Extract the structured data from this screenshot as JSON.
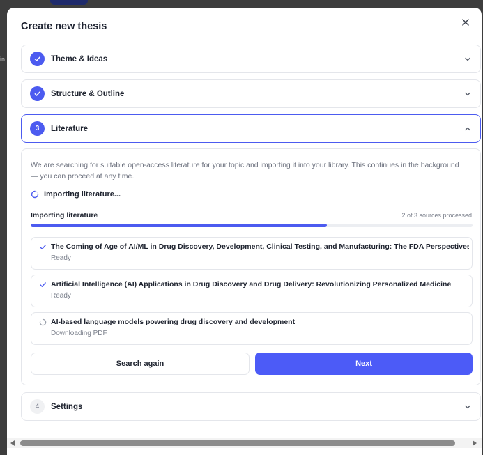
{
  "modal": {
    "title": "Create new thesis",
    "close_icon": "close-icon"
  },
  "steps": [
    {
      "badge": "",
      "label": "Theme & Ideas",
      "state": "done",
      "icon": "check-icon"
    },
    {
      "badge": "",
      "label": "Structure & Outline",
      "state": "done",
      "icon": "check-icon"
    },
    {
      "badge": "3",
      "label": "Literature",
      "state": "active",
      "icon": "chevron-up-icon"
    },
    {
      "badge": "4",
      "label": "Settings",
      "state": "pending",
      "icon": "chevron-down-icon"
    }
  ],
  "literature": {
    "intro": "We are searching for suitable open-access literature for your topic and importing it into your library. This continues in the background — you can proceed at any time.",
    "loading_text": "Importing literature...",
    "progress_label": "Importing literature",
    "progress_count": "2 of 3 sources processed",
    "progress_fraction": 0.67,
    "sources": [
      {
        "title": "The Coming of Age of AI/ML in Drug Discovery, Development, Clinical Testing, and Manufacturing: The FDA Perspectives",
        "status": "Ready",
        "icon": "check-icon"
      },
      {
        "title": "Artificial Intelligence (AI) Applications in Drug Discovery and Drug Delivery: Revolutionizing Personalized Medicine",
        "status": "Ready",
        "icon": "check-icon"
      },
      {
        "title": "AI-based language models powering drug discovery and development",
        "status": "Downloading PDF",
        "icon": "spinner-icon"
      }
    ],
    "search_again_label": "Search again",
    "next_label": "Next"
  },
  "background": {
    "left_fragment": "in"
  },
  "colors": {
    "accent": "#4c5bf0",
    "primary_button": "#4c5bf7",
    "border": "#e4e6eb",
    "muted_text": "#6a6f7c",
    "backdrop": "#3d3d3d"
  }
}
